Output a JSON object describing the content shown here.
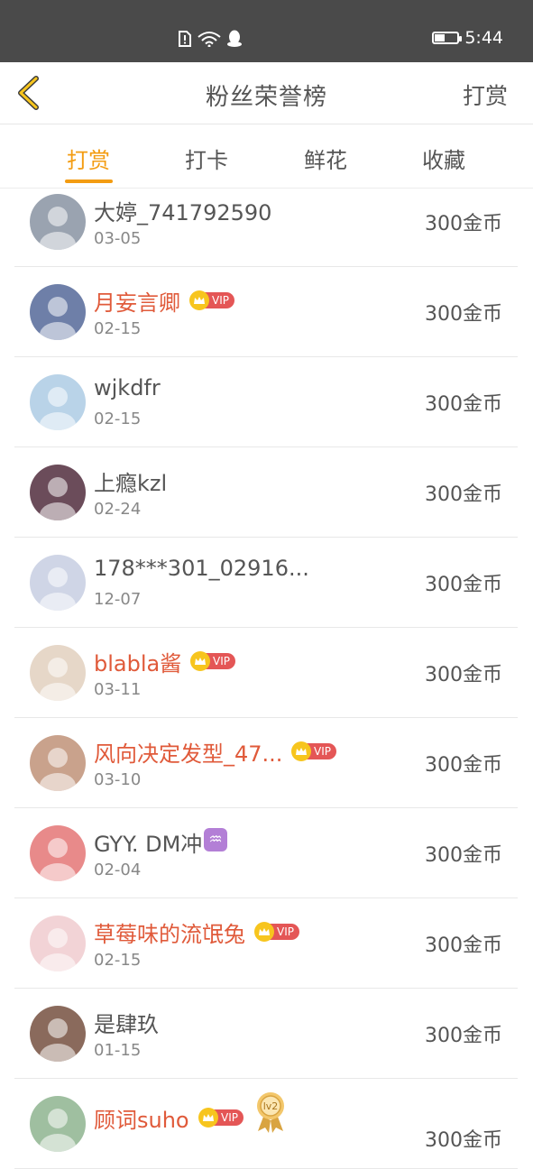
{
  "status_bar": {
    "time": "5:44",
    "battery_level": 0.45,
    "icons": [
      "sim-alert-icon",
      "wifi-icon",
      "qq-icon"
    ]
  },
  "nav": {
    "title": "粉丝荣誉榜",
    "action_label": "打赏",
    "back_icon": "chevron-left-icon",
    "accent": "#f39c12"
  },
  "tabs": [
    {
      "label": "打赏",
      "active": true
    },
    {
      "label": "打卡",
      "active": false
    },
    {
      "label": "鲜花",
      "active": false
    },
    {
      "label": "收藏",
      "active": false
    }
  ],
  "vip_label": "VIP",
  "level_label": "lv2",
  "fans": [
    {
      "name": "大婷_741792590",
      "date": "03-05",
      "amount": "300金币",
      "vip": false,
      "avatar_color": "#9aa3b0"
    },
    {
      "name": "月妄言卿",
      "date": "02-15",
      "amount": "300金币",
      "vip": true,
      "avatar_color": "#6e7fa8"
    },
    {
      "name": "wjkdfr",
      "date": "02-15",
      "amount": "300金币",
      "vip": false,
      "avatar_color": "#b9d3e8"
    },
    {
      "name": "上瘾kzl",
      "date": "02-24",
      "amount": "300金币",
      "vip": false,
      "avatar_color": "#6b4c5a"
    },
    {
      "name": "178***301_02916...",
      "date": "12-07",
      "amount": "300金币",
      "vip": false,
      "avatar_color": "#cfd5e6"
    },
    {
      "name": "blabla酱",
      "date": "03-11",
      "amount": "300金币",
      "vip": true,
      "avatar_color": "#e6d7c8"
    },
    {
      "name": "风向决定发型_47...",
      "date": "03-10",
      "amount": "300金币",
      "vip": true,
      "avatar_color": "#c9a28c"
    },
    {
      "name": "GYY. DM冲",
      "date": "02-04",
      "amount": "300金币",
      "vip": false,
      "zodiac": "♒",
      "avatar_color": "#e88a8a"
    },
    {
      "name": "草莓味的流氓兔",
      "date": "02-15",
      "amount": "300金币",
      "vip": true,
      "avatar_color": "#f2d3d6"
    },
    {
      "name": "是肆玖",
      "date": "01-15",
      "amount": "300金币",
      "vip": false,
      "avatar_color": "#8a6a5c"
    },
    {
      "name": "顾词suho",
      "date": "",
      "amount": "300金币",
      "vip": true,
      "level": true,
      "avatar_color": "#9fbfa0"
    }
  ]
}
